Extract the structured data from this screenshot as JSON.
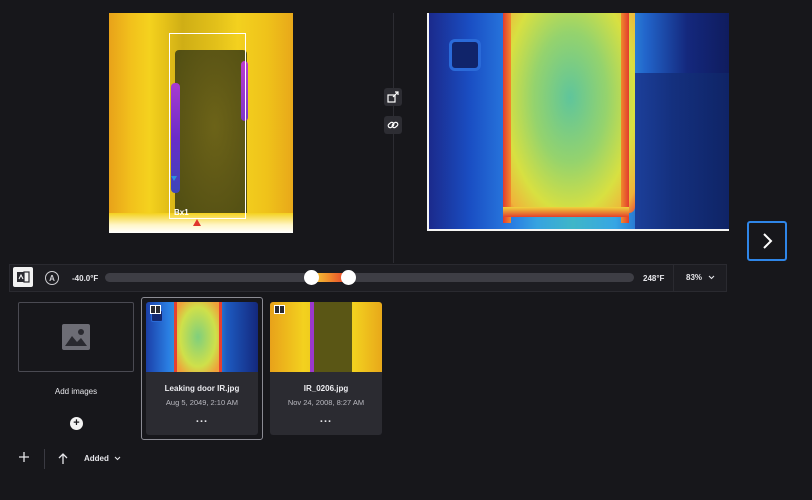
{
  "viewer": {
    "left_image": {
      "roi_label": "Bx1"
    },
    "tools": [
      "share-icon",
      "link-icon"
    ],
    "next_icon": "chevron-right-icon"
  },
  "palette_bar": {
    "auto_label": "A",
    "min_temp": "-40.0°F",
    "max_temp": "248°F",
    "range_low_fraction": 0.39,
    "range_high_fraction": 0.46,
    "zoom": "83%"
  },
  "gallery": {
    "add_images_label": "Add images",
    "items": [
      {
        "name": "Leaking door IR.jpg",
        "date": "Aug 5, 2049, 2:10 AM",
        "more": "...",
        "selected": true
      },
      {
        "name": "IR_0206.jpg",
        "date": "Nov 24, 2008, 8:27 AM",
        "more": "...",
        "selected": false
      }
    ]
  },
  "bottom_toolbar": {
    "sort_label": "Added"
  },
  "colors": {
    "background": "#17171b",
    "accent": "#2f86e8",
    "card": "#2b2b31"
  }
}
